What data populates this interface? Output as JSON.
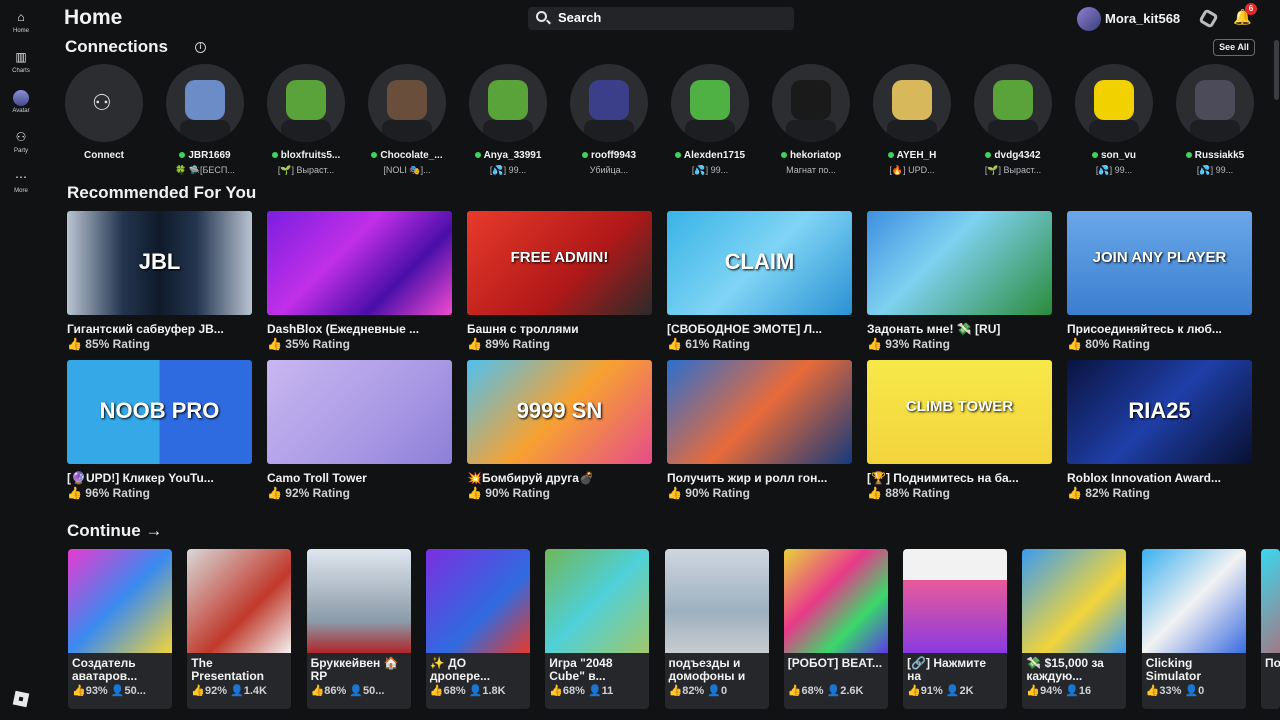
{
  "sidebar": {
    "items": [
      {
        "label": "Home",
        "icon": "home-icon"
      },
      {
        "label": "Charts",
        "icon": "charts-icon"
      },
      {
        "label": "Avatar",
        "icon": "avatar-icon"
      },
      {
        "label": "Party",
        "icon": "party-icon"
      },
      {
        "label": "More",
        "icon": "more-icon"
      }
    ]
  },
  "header": {
    "title": "Home",
    "search_placeholder": "Search",
    "username": "Mora_kit568",
    "notifications_count": "6"
  },
  "connections": {
    "title": "Connections",
    "see_all": "See All",
    "connect_label": "Connect",
    "friends": [
      {
        "name": "JBR1669",
        "status": "🍀 🛸[БЕСП...",
        "color": "#6b8cc7"
      },
      {
        "name": "bloxfruits5...",
        "status": "[🌱] Выраст...",
        "color": "#5aa23a"
      },
      {
        "name": "Chocolate_...",
        "status": "[NOLI 🎭]...",
        "color": "#6a4e3c"
      },
      {
        "name": "Anya_33991",
        "status": "[💦] 99...",
        "color": "#5aa23a"
      },
      {
        "name": "rooff9943",
        "status": "Убийца...",
        "color": "#3b3f8a"
      },
      {
        "name": "Alexden1715",
        "status": "[💦] 99...",
        "color": "#4fb043"
      },
      {
        "name": "hekoriatop",
        "status": "Магнат по...",
        "color": "#1a1a1a"
      },
      {
        "name": "AYEH_H",
        "status": "[🔥] UPD...",
        "color": "#d7b85a"
      },
      {
        "name": "dvdg4342",
        "status": "[🌱] Выраст...",
        "color": "#5aa23a"
      },
      {
        "name": "son_vu",
        "status": "[💦] 99...",
        "color": "#f2d100"
      },
      {
        "name": "Russiakk5",
        "status": "[💦] 99...",
        "color": "#4b4b5a"
      }
    ]
  },
  "recommended": {
    "title": "Recommended For You",
    "games": [
      {
        "name": "Гигантский сабвуфер JB...",
        "rating": "85% Rating",
        "thumb_text": "JBL",
        "bg": "linear-gradient(90deg,#b9c4d3 0%,#24354f 30%,#0f1a2b 50%,#24354f 70%,#b9c4d3 100%)"
      },
      {
        "name": "DashBlox (Ежедневные ...",
        "rating": "35% Rating",
        "thumb_text": "",
        "bg": "linear-gradient(135deg,#7b1fe0,#c12fe8 40%,#4a0ea8 70%,#f24bd0)"
      },
      {
        "name": "Башня с троллями",
        "rating": "89% Rating",
        "thumb_text": "FREE ADMIN!",
        "bg": "linear-gradient(135deg,#e83a2b,#b01818 60%,#2b2b2b)"
      },
      {
        "name": "[СВОБОДНОЕ ЭМОТЕ] Л...",
        "rating": "61% Rating",
        "thumb_text": "CLAIM",
        "bg": "linear-gradient(135deg,#39b3e6,#7fd4f5 50%,#2a91d2)"
      },
      {
        "name": "Задонать мне! 💸 [RU]",
        "rating": "93% Rating",
        "thumb_text": "",
        "bg": "linear-gradient(135deg,#3d8fe0,#7fd1f0 40%,#2a8c3a)"
      },
      {
        "name": "Присоединяйтесь к люб...",
        "rating": "80% Rating",
        "thumb_text": "JOIN ANY PLAYER",
        "bg": "linear-gradient(180deg,#6aa7e8,#3b7fd0)"
      },
      {
        "name": "[🔮UPD!] Кликер YouTu...",
        "rating": "96% Rating",
        "thumb_text": "NOOB  PRO",
        "bg": "linear-gradient(90deg,#35a8e8 50%,#2f6be0 50%)"
      },
      {
        "name": "Camo Troll Tower",
        "rating": "92% Rating",
        "thumb_text": "",
        "bg": "linear-gradient(135deg,#c8b7f0,#a999e4 60%,#8d7fd8)"
      },
      {
        "name": "💥Бомбируй друга💣",
        "rating": "90% Rating",
        "thumb_text": "9999 SN",
        "bg": "linear-gradient(135deg,#4ec1f0,#f7a230 50%,#e64c8a)"
      },
      {
        "name": "Получить жир и ролл гон...",
        "rating": "90% Rating",
        "thumb_text": "",
        "bg": "linear-gradient(135deg,#2b6fd0,#e86b3a 50%,#153a7a)"
      },
      {
        "name": "[🏆] Поднимитесь на ба...",
        "rating": "88% Rating",
        "thumb_text": "CLIMB TOWER",
        "bg": "linear-gradient(180deg,#f7e94a,#f3d33b)"
      },
      {
        "name": "Roblox Innovation Award...",
        "rating": "82% Rating",
        "thumb_text": "RIA25",
        "bg": "linear-gradient(135deg,#0a1440,#1f3fa8 50%,#081030)"
      }
    ]
  },
  "continue": {
    "title": "Continue →",
    "games": [
      {
        "name": "Создатель аватаров...",
        "stats": "👍93% 👤50...",
        "bg": "linear-gradient(135deg,#e83ad0,#3a8af0 50%,#f2d43a)"
      },
      {
        "name": "The Presentation",
        "stats": "👍92% 👤1.4K",
        "bg": "linear-gradient(135deg,#d8d8d8,#c0392b 60%,#f2f2f2)"
      },
      {
        "name": "Бруккейвен 🏠 RP",
        "stats": "👍86% 👤50...",
        "bg": "linear-gradient(180deg,#dfe6ee,#8a9aa8 70%,#b0262a)"
      },
      {
        "name": "✨ ДО дропере...",
        "stats": "👍68% 👤1.8K",
        "bg": "linear-gradient(135deg,#7b2fe0,#2f6be0 60%,#e83a2b)"
      },
      {
        "name": "Игра \"2048 Cube\" в...",
        "stats": "👍68% 👤11",
        "bg": "linear-gradient(135deg,#6fb65a,#4fd0d8 50%,#a0c76a)"
      },
      {
        "name": "подъезды и домофоны и",
        "stats": "👍82% 👤0",
        "bg": "linear-gradient(180deg,#cfd6e0,#9eb0bf 60%,#c7cccf)"
      },
      {
        "name": "[РОБОТ] BEAT...",
        "stats": "👍68% 👤2.6K",
        "bg": "linear-gradient(135deg,#e8d23a,#e83a8a 40%,#3ad86a 70%,#5a3ae8)"
      },
      {
        "name": "[🔗] Нажмите на",
        "stats": "👍91% 👤2K",
        "bg": "linear-gradient(180deg,#f2f2f2 0%,#f2f2f2 30%,#e85a9a 30%,#8a3ae0)"
      },
      {
        "name": "💸 $15,000 за каждую...",
        "stats": "👍94% 👤16",
        "bg": "linear-gradient(135deg,#3a9cf0,#f2d43a 60%,#3a9cf0)"
      },
      {
        "name": "Clicking Simulator",
        "stats": "👍33% 👤0",
        "bg": "linear-gradient(135deg,#3ab0f0,#f2f2f2 50%,#3a6be0)"
      },
      {
        "name": "По...",
        "stats": "",
        "bg": "linear-gradient(135deg,#3ad8f0,#e83a3a)"
      }
    ]
  }
}
